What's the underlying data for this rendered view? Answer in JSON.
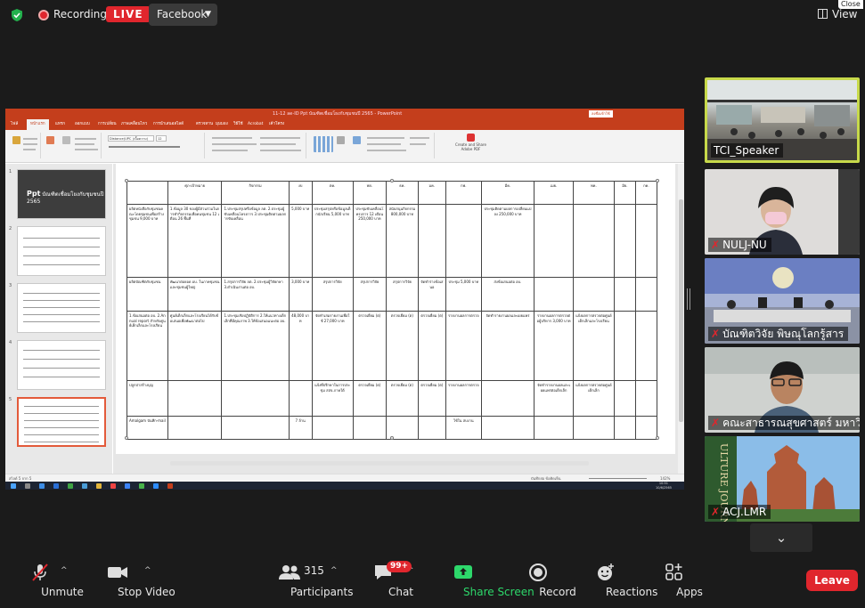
{
  "topbar": {
    "recording_label": "Recording",
    "live_label": "LIVE",
    "facebook_label": "Facebook",
    "view_label": "View",
    "close_label": "Close"
  },
  "powerpoint": {
    "title": "11-12 ลด-ID Ppt บัณฑิตเชื่อมโยงกับชุมชนปี 2565 - PowerPoint",
    "signin": "ลงชื่อเข้าใช้",
    "tabs": [
      "ไฟล์",
      "หน้าแรก",
      "แทรก",
      "ออกแบบ",
      "การเปลี่ยน",
      "ภาพเคลื่อนไหว",
      "การนำเสนอสไลด์",
      "ตรวจทาน",
      "มุมมอง",
      "วิธีใช้",
      "Acrobat",
      "เค้าโครง"
    ],
    "font_name": "Distance(UPC (เนื้อความ)",
    "font_size": "12",
    "acrobat_btn": "Create and Share Adobe PDF",
    "status_left": "สไลด์ 5 จาก 5",
    "status_right": "บันทึกย่อ   ข้อคิดเห็น",
    "zoom": "142%",
    "clock_time": "10:51",
    "clock_date": "10/6/2565"
  },
  "thumbnails": [
    {
      "num": "1",
      "title_big": "Ppt",
      "title_small": "บัณฑิตเชื่อมโยงกับชุมชนปี 2565"
    },
    {
      "num": "2"
    },
    {
      "num": "3"
    },
    {
      "num": "4"
    },
    {
      "num": "5"
    }
  ],
  "table": {
    "header": [
      "",
      "ศุภ-เป้าหมาย",
      "กิจกรรม",
      "งบ",
      "ตค.",
      "พย.",
      "ธค.",
      "มค.",
      "กพ.",
      "มีค.",
      "เมย.",
      "พค.",
      "มิย.",
      "กค."
    ],
    "rows": [
      [
        "ผลิตหนังสือกับชุมชนคณะโดยชุมชนเพื่อสร้างชุมชน 9,000 บาท",
        "1.ข้อมูล 30 ของผู้มีส่วนร่วมในการทำกิจกรรมเพื่อคนชุมชน 12 เดือน 26 พื้นที่",
        "1.ประชุมสรุปหรือข้อมูล ลต. 2.ประชุมผู้ขับเคลื่อนโครงการ 3.ประชุมติดตามผลการขับเคลื่อน",
        "5,000 บาท",
        "ประชุมสรุปหรือข้อมูลเด็กนักเรียน 5,000 บาท",
        "ประชุมขับเคลื่อนโครงการ 12 เดือน 250,000 บาท",
        "สนับสนุนกิจกรรม 800,000 บาท",
        "",
        "",
        "ประชุมติดตามผลการเปลี่ยนแปลง 250,000 บาท",
        "",
        "",
        "",
        ""
      ],
      [
        "ผลิตบัณฑิตกับชุมชน",
        "พัฒนาต่อยอด อบ. ในภาคชุมชนและชุมชนผู้ใหญ่",
        "1.สรุปการวิจัย ลต. 2.ประชุมผู้วิจัยกษา 3.ดำเนินงานต่อ อบ.",
        "3,000 บาท",
        "สรุปการวิจัย",
        "สรุปการวิจัย",
        "สรุปการวิจัย",
        "จัดทำร่างข้อเสนอ",
        "ประชุม 5,000 บาท",
        "ส่งข้อเสนอต่อ อบ.",
        "",
        "",
        "",
        ""
      ],
      [
        "1.ข้อเสนอต่อ อบ. 2.Annual report สำหรับศูนย์เด็กเล็กและโรงเรียน",
        "ศูนย์เด็กเล็กและโรงเรียนได้รับข้อเสนอเพื่อพัฒนาต่อไป",
        "1.ประชุมเชิงปฏิบัติการ 2.ให้แนวทางเด็กเล็กที่มีคุณภาพ 3.ให้ข้อเสนอแนะต่อ อบ.",
        "48,000 บาท",
        "จัดทำเล่มรายงานเพื่อใช้ 27,000 บาท",
        "ตรวจเยี่ยม (ต)",
        "ตรวจเยี่ยม (ต)",
        "ตรวจเยี่ยม (ต)",
        "รายงานผลการตรวจ",
        "จัดทำรายงานผลและเผยแพร่",
        "รายงานผลการตรวจต่อผู้บริหาร 3,000 บาท",
        "แจ้งผลการตรวจต่อศูนย์เด็กเล็กและโรงเรียน",
        "",
        ""
      ],
      [
        "ปลูกป่าสร้างบุญ",
        "",
        "",
        "",
        "แจ้งที่ปรึกษาในการประชุม สสจ.ภาคใต้",
        "ตรวจเยี่ยม (ต)",
        "ตรวจเยี่ยม (ต)",
        "ตรวจเยี่ยม (ต)",
        "รายงานผลการตรวจ",
        "",
        "จัดทำรายงานผลและเผยแพร่ต่อเด็กเล็ก",
        "แจ้งผลการตรวจต่อศูนย์เด็กเล็ก",
        "",
        ""
      ],
      [
        "Amalgam บันทึก-mail",
        "",
        "",
        "7 ล้าน",
        "",
        "",
        "",
        "",
        "ใช้ใน สบงาน",
        "",
        "",
        "",
        "",
        ""
      ]
    ]
  },
  "participants_gallery": [
    {
      "name": "TCI_Speaker",
      "muted": false,
      "active": true
    },
    {
      "name": "NULJ-NU",
      "muted": true,
      "active": false
    },
    {
      "name": "บัณฑิตวิจัย พิษณุโลกรู้สาร",
      "muted": true,
      "active": false
    },
    {
      "name": "คณะสาธารณสุขศาสตร์ มหาวิ...",
      "muted": true,
      "active": false
    },
    {
      "name": "ACJ.LMR",
      "muted": true,
      "active": false
    }
  ],
  "toolbar": {
    "unmute": "Unmute",
    "stop_video": "Stop Video",
    "participants": "Participants",
    "participants_count": "315",
    "chat": "Chat",
    "chat_badge": "99+",
    "share_screen": "Share Screen",
    "record": "Record",
    "reactions": "Reactions",
    "apps": "Apps",
    "leave": "Leave"
  },
  "colors": {
    "ppt_accent": "#c43e1c",
    "leave_red": "#e0262d",
    "share_green": "#2dd86b",
    "active_speaker_border": "#c7d94a"
  }
}
